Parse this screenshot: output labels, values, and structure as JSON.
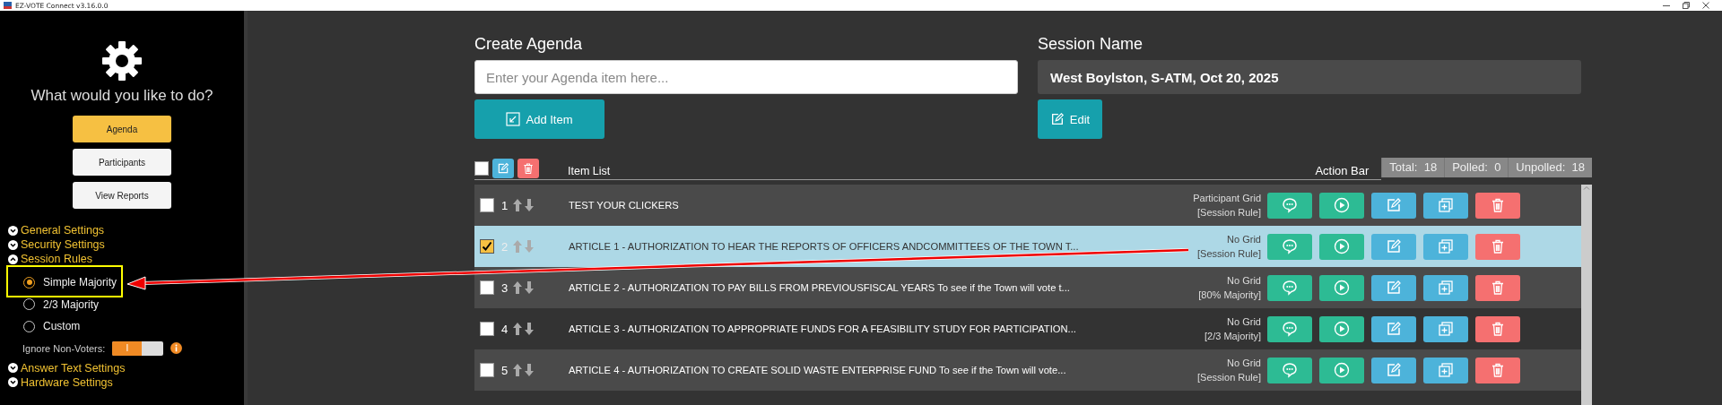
{
  "window": {
    "title": "EZ-VOTE Connect v3.16.0.0"
  },
  "sidebar": {
    "prompt": "What would you like to do?",
    "nav_buttons": [
      {
        "label": "Agenda",
        "selected": true
      },
      {
        "label": "Participants",
        "selected": false
      },
      {
        "label": "View Reports",
        "selected": false
      }
    ],
    "sections": [
      {
        "label": "General Settings",
        "expanded": false
      },
      {
        "label": "Security Settings",
        "expanded": false
      },
      {
        "label": "Session Rules",
        "expanded": true,
        "options": [
          {
            "label": "Simple Majority",
            "selected": true
          },
          {
            "label": "2/3 Majority",
            "selected": false
          },
          {
            "label": "Custom",
            "selected": false
          }
        ],
        "toggle": {
          "label": "Ignore Non-Voters:",
          "on": true,
          "knob": "I"
        }
      },
      {
        "label": "Answer Text Settings",
        "expanded": false
      },
      {
        "label": "Hardware Settings",
        "expanded": false
      }
    ]
  },
  "agenda": {
    "title": "Create Agenda",
    "placeholder": "Enter your Agenda item here...",
    "add_button": "Add Item"
  },
  "session": {
    "title": "Session Name",
    "value": "West Boylston, S-ATM, Oct 20, 2025",
    "edit_button": "Edit"
  },
  "item_list": {
    "header": "Item List",
    "action_header": "Action Bar",
    "all_checked": false,
    "stats": [
      {
        "label": "Total:",
        "value": "18"
      },
      {
        "label": "Polled:",
        "value": "0"
      },
      {
        "label": "Unpolled:",
        "value": "18"
      }
    ],
    "rows": [
      {
        "number": "1",
        "title": "TEST YOUR CLICKERS",
        "grid": "Participant Grid",
        "rule": "[Session Rule]",
        "checked": false,
        "selected": false
      },
      {
        "number": "2",
        "title": "ARTICLE 1 - AUTHORIZATION TO HEAR THE REPORTS OF OFFICERS ANDCOMMITTEES OF THE TOWN T...",
        "grid": "No Grid",
        "rule": "[Session Rule]",
        "checked": true,
        "selected": true
      },
      {
        "number": "3",
        "title": "ARTICLE 2 - AUTHORIZATION TO PAY BILLS FROM PREVIOUSFISCAL YEARS To see if the Town will vote t...",
        "grid": "No Grid",
        "rule": "[80% Majority]",
        "checked": false,
        "selected": false
      },
      {
        "number": "4",
        "title": "ARTICLE 3 - AUTHORIZATION TO APPROPRIATE FUNDS FOR A FEASIBILITY STUDY FOR PARTICIPATION...",
        "grid": "No Grid",
        "rule": "[2/3 Majority]",
        "checked": false,
        "selected": false
      },
      {
        "number": "5",
        "title": "ARTICLE 4 -  AUTHORIZATION TO CREATE SOLID WASTE ENTERPRISE FUND To see if the Town will vote...",
        "grid": "No Grid",
        "rule": "[Session Rule]",
        "checked": false,
        "selected": false
      }
    ]
  }
}
